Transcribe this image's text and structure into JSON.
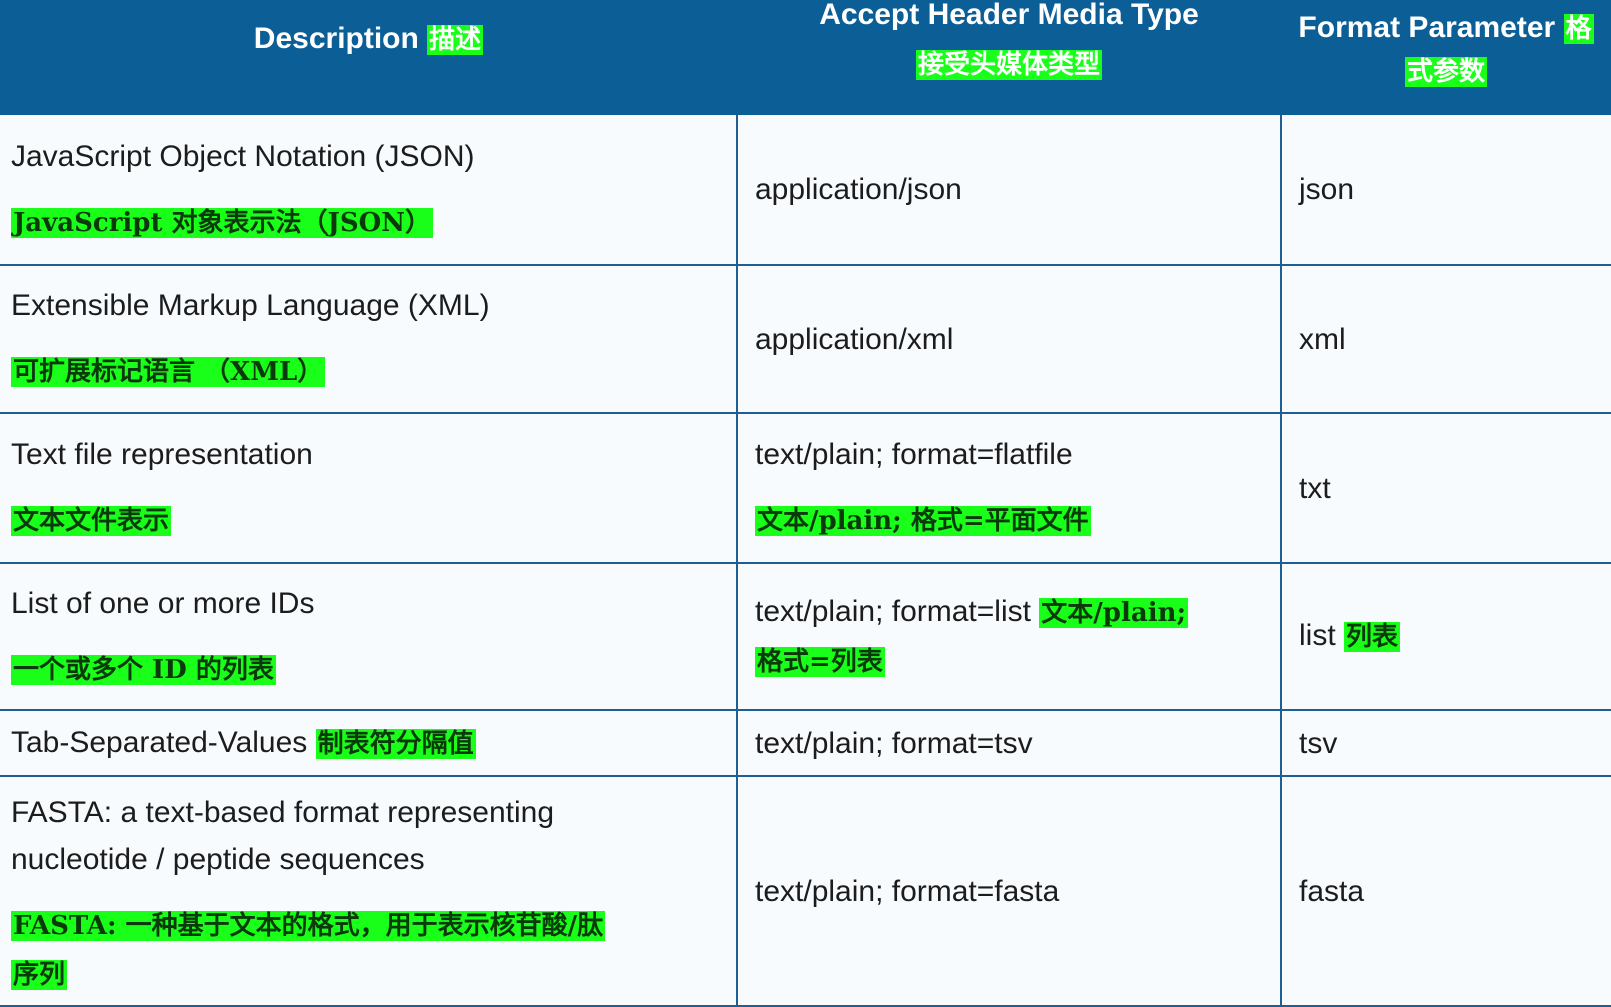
{
  "header": {
    "description": "Description",
    "description_zh": "描述",
    "media_type": "Accept Header Media Type",
    "media_type_zh": "接受头媒体类型",
    "format_param": "Format Parameter",
    "format_param_zh_a": "格",
    "format_param_zh_b": "式参数"
  },
  "rows": [
    {
      "description": "JavaScript Object Notation (JSON)",
      "description_zh": "JavaScript 对象表示法（JSON）",
      "media_type": "application/json",
      "format": "json"
    },
    {
      "description": "Extensible Markup Language (XML)",
      "description_zh": "可扩展标记语言 （XML）",
      "media_type": "application/xml",
      "format": "xml"
    },
    {
      "description": "Text file representation",
      "description_zh": "文本文件表示",
      "media_type": "text/plain; format=flatfile",
      "media_type_zh": "文本/plain; 格式=平面文件",
      "format": "txt"
    },
    {
      "description": "List of one or more IDs",
      "description_zh": "一个或多个 ID 的列表",
      "media_type": "text/plain; format=list",
      "media_type_zh_a": "文本/plain;",
      "media_type_zh_b": "格式=列表",
      "format": "list",
      "format_zh": "列表"
    },
    {
      "description": "Tab-Separated-Values",
      "description_zh": "制表符分隔值",
      "media_type": "text/plain; format=tsv",
      "format": "tsv"
    },
    {
      "description_a": "FASTA: a text-based format representing",
      "description_b": "nucleotide / peptide sequences",
      "description_zh_a": "FASTA: 一种基于文本的格式，用于表示核苷酸/肽",
      "description_zh_b": "序列",
      "media_type": "text/plain; format=fasta",
      "format": "fasta"
    }
  ]
}
